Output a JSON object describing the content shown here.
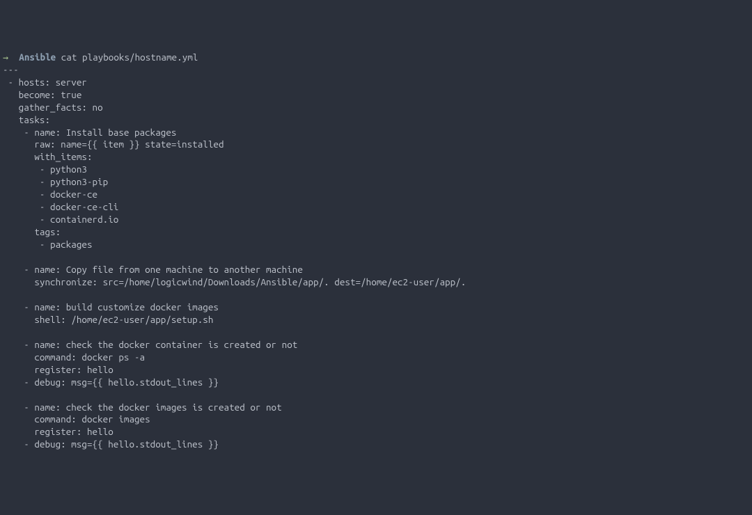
{
  "prompt": {
    "arrow": "→",
    "cwd": "Ansible",
    "command": "cat playbooks/hostname.yml"
  },
  "lines": [
    "---",
    " - hosts: server",
    "   become: true",
    "   gather_facts: no",
    "   tasks:",
    "    - name: Install base packages",
    "      raw: name={{ item }} state=installed",
    "      with_items:",
    "       - python3",
    "       - python3-pip",
    "       - docker-ce",
    "       - docker-ce-cli",
    "       - containerd.io",
    "      tags:",
    "       - packages",
    "",
    "    - name: Copy file from one machine to another machine",
    "      synchronize: src=/home/logicwind/Downloads/Ansible/app/. dest=/home/ec2-user/app/.",
    "",
    "    - name: build customize docker images",
    "      shell: /home/ec2-user/app/setup.sh",
    "",
    "    - name: check the docker container is created or not",
    "      command: docker ps -a",
    "      register: hello",
    "    - debug: msg={{ hello.stdout_lines }}",
    "",
    "    - name: check the docker images is created or not",
    "      command: docker images",
    "      register: hello",
    "    - debug: msg={{ hello.stdout_lines }}"
  ]
}
